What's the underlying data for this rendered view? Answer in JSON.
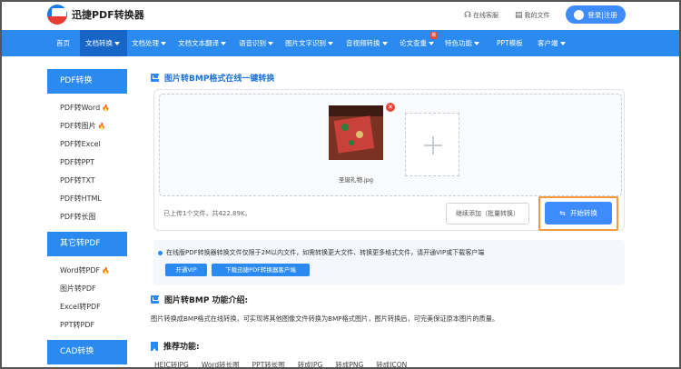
{
  "header": {
    "logo_text": "迅捷PDF转换器",
    "support": "在线客服",
    "my_docs": "我的文件",
    "login": "登录|注册"
  },
  "nav": [
    "首页",
    "文档转换",
    "文档处理",
    "文档文本翻译",
    "语音识别",
    "图片文字识别",
    "音视频转换",
    "论文查重",
    "特色功能",
    "PPT模板",
    "客户端"
  ],
  "nav_hot_badge": "新",
  "sidebar": {
    "sec1": "PDF转换",
    "sec1_items": [
      "PDF转Word",
      "PDF转图片",
      "PDF转Excel",
      "PDF转PPT",
      "PDF转TXT",
      "PDF转HTML",
      "PDF转长图"
    ],
    "sec2": "其它转PDF",
    "sec2_items": [
      "Word转PDF",
      "图片转PDF",
      "Excel转PDF",
      "PPT转PDF"
    ],
    "sec3": "CAD转换"
  },
  "main": {
    "title": "图片转BMP格式在线一键转换",
    "file_name": "圣诞礼物.jpg",
    "uploaded_info": "已上传1个文件，共422.89K。",
    "continue_btn": "继续添加（批量转换）",
    "start_btn": "开始转换",
    "notice": "在线版PDF转换器转换文件仅限于2M以内文件，如需转换更大文件、转换更多格式文件，请开通VIP或下载客户端",
    "vip_btn": "开通VIP",
    "download_btn": "下载迅捷PDF转换器客户端",
    "intro_title": "图片转BMP 功能介绍:",
    "intro_text": "图片转换成BMP格式在线转换，可实现将其他图像文件转换为BMP格式图片，图片转换后，可完美保证原本图片的质量。",
    "rec_title": "推荐功能:",
    "rec_items": [
      "HEIC转JPG",
      "Word转长图",
      "PPT转长图",
      "转成JPG",
      "转成PNG",
      "转成ICON"
    ]
  },
  "colors": {
    "primary": "#2a8af0",
    "accent": "#f49a3b",
    "danger": "#e8483b"
  }
}
